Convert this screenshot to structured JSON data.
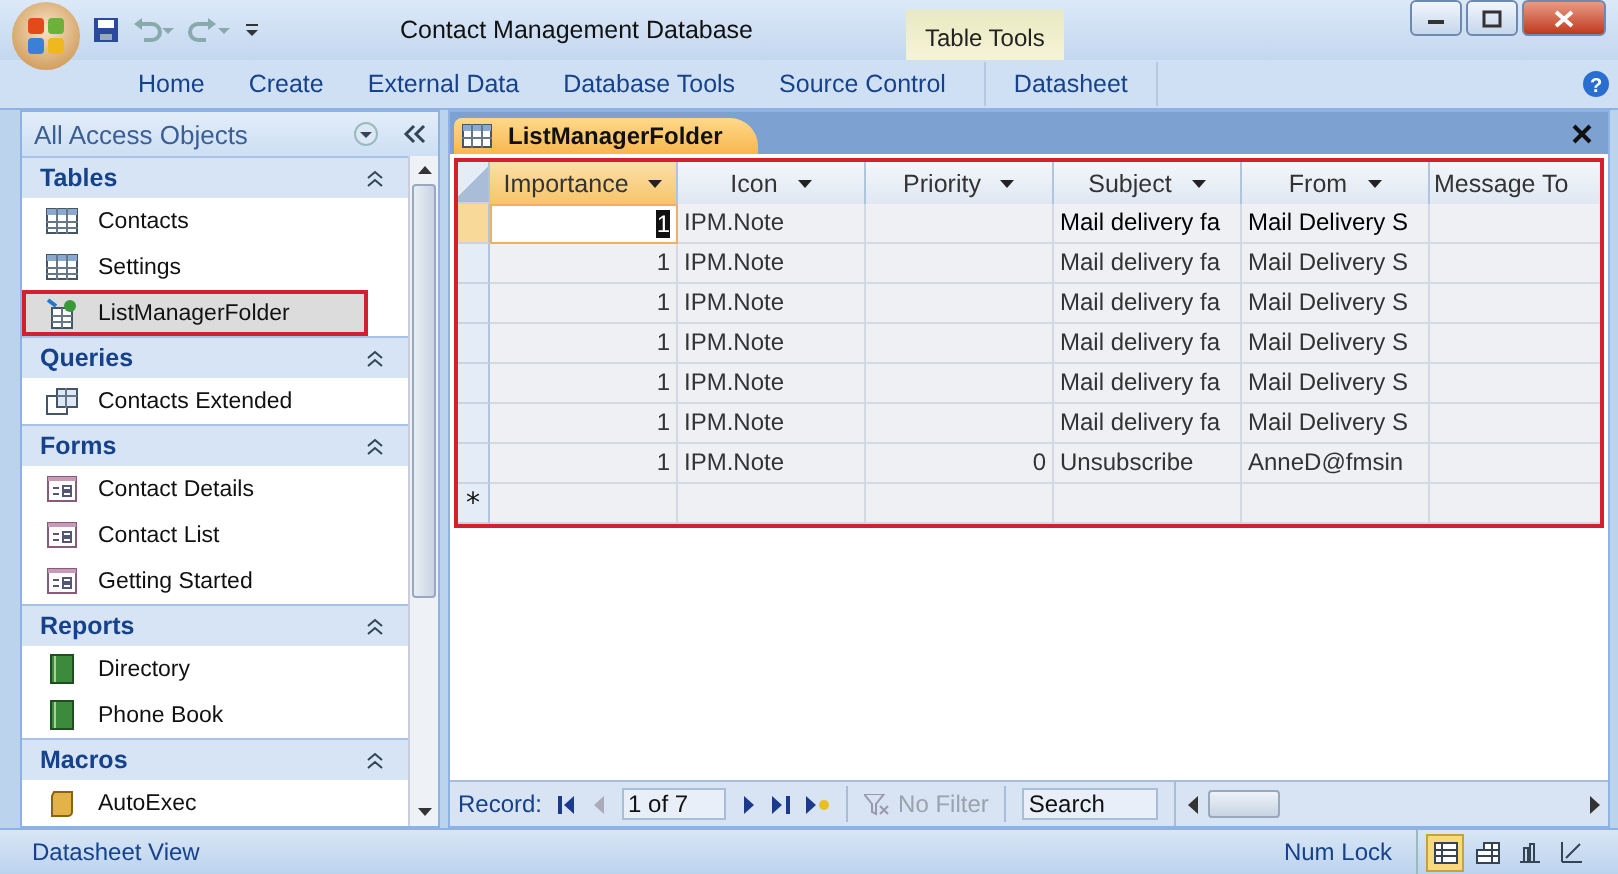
{
  "window": {
    "title": "Contact Management Database",
    "contextual_tab": "Table Tools"
  },
  "help_glyph": "?",
  "ribbon_tabs": [
    {
      "label": "Home",
      "selected": false
    },
    {
      "label": "Create",
      "selected": false
    },
    {
      "label": "External Data",
      "selected": false
    },
    {
      "label": "Database Tools",
      "selected": false
    },
    {
      "label": "Source Control",
      "selected": false
    },
    {
      "label": "Datasheet",
      "selected": false
    }
  ],
  "nav": {
    "title": "All Access Objects",
    "groups": [
      {
        "label": "Tables",
        "items": [
          {
            "label": "Contacts",
            "kind": "table",
            "selected": false
          },
          {
            "label": "Settings",
            "kind": "table",
            "selected": false
          },
          {
            "label": "ListManagerFolder",
            "kind": "linked",
            "selected": true
          }
        ]
      },
      {
        "label": "Queries",
        "items": [
          {
            "label": "Contacts Extended",
            "kind": "query",
            "selected": false
          }
        ]
      },
      {
        "label": "Forms",
        "items": [
          {
            "label": "Contact Details",
            "kind": "form",
            "selected": false
          },
          {
            "label": "Contact List",
            "kind": "form",
            "selected": false
          },
          {
            "label": "Getting Started",
            "kind": "form",
            "selected": false
          }
        ]
      },
      {
        "label": "Reports",
        "items": [
          {
            "label": "Directory",
            "kind": "report",
            "selected": false
          },
          {
            "label": "Phone Book",
            "kind": "report",
            "selected": false
          }
        ]
      },
      {
        "label": "Macros",
        "items": [
          {
            "label": "AutoExec",
            "kind": "macro",
            "selected": false
          }
        ]
      }
    ]
  },
  "document_tab": {
    "label": "ListManagerFolder"
  },
  "table": {
    "columns": [
      "Importance",
      "Icon",
      "Priority",
      "Subject",
      "From",
      "Message To"
    ],
    "rows": [
      {
        "selected": true,
        "cells": [
          "1",
          "IPM.Note",
          "",
          "Mail delivery fa",
          "Mail Delivery S",
          ""
        ]
      },
      {
        "selected": false,
        "cells": [
          "1",
          "IPM.Note",
          "",
          "Mail delivery fa",
          "Mail Delivery S",
          ""
        ]
      },
      {
        "selected": false,
        "cells": [
          "1",
          "IPM.Note",
          "",
          "Mail delivery fa",
          "Mail Delivery S",
          ""
        ]
      },
      {
        "selected": false,
        "cells": [
          "1",
          "IPM.Note",
          "",
          "Mail delivery fa",
          "Mail Delivery S",
          ""
        ]
      },
      {
        "selected": false,
        "cells": [
          "1",
          "IPM.Note",
          "",
          "Mail delivery fa",
          "Mail Delivery S",
          ""
        ]
      },
      {
        "selected": false,
        "cells": [
          "1",
          "IPM.Note",
          "",
          "Mail delivery fa",
          "Mail Delivery S",
          ""
        ]
      },
      {
        "selected": false,
        "cells": [
          "1",
          "IPM.Note",
          "0",
          "Unsubscribe",
          "AnneD@fmsin",
          ""
        ]
      }
    ],
    "new_row_marker": "*"
  },
  "record_nav": {
    "label": "Record:",
    "position": "1 of 7",
    "filter": "No Filter",
    "filter_disabled": true,
    "search_placeholder": "Search"
  },
  "status_bar": {
    "left": "Datasheet View",
    "num_lock": "Num Lock",
    "views": [
      {
        "kind": "datasheet",
        "selected": true
      },
      {
        "kind": "pivot-table",
        "selected": false
      },
      {
        "kind": "pivot-chart",
        "selected": false
      },
      {
        "kind": "design",
        "selected": false
      }
    ]
  }
}
